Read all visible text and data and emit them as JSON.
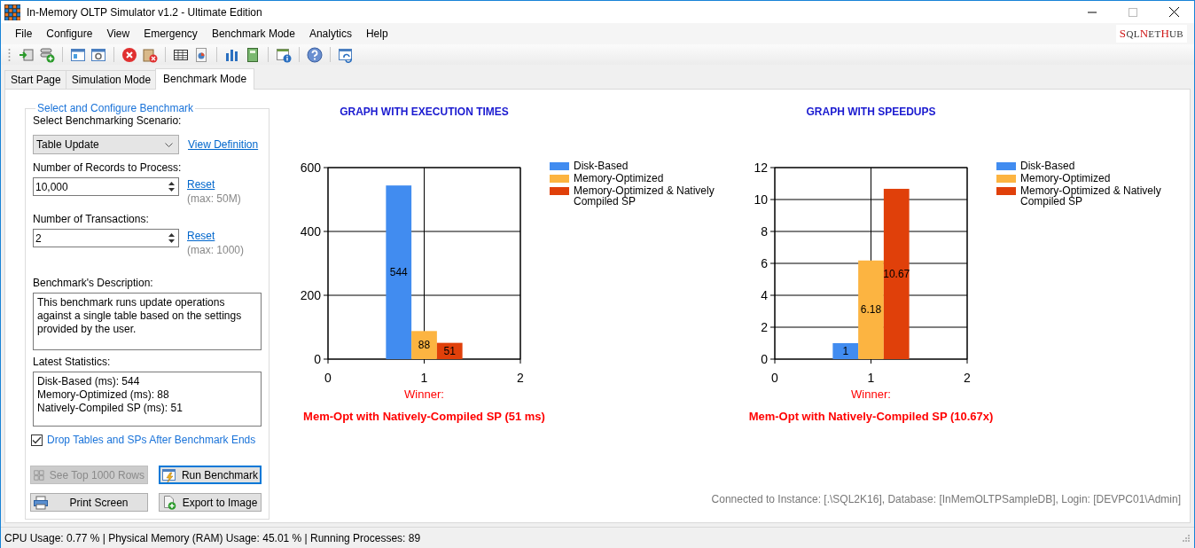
{
  "window": {
    "title": "In-Memory OLTP Simulator v1.2 - Ultimate Edition"
  },
  "menu": [
    "File",
    "Configure",
    "View",
    "Emergency",
    "Benchmark Mode",
    "Analytics",
    "Help"
  ],
  "logo": [
    {
      "text": "S",
      "accent": true
    },
    {
      "text": "QL",
      "accent": false
    },
    {
      "text": "N",
      "accent": true
    },
    {
      "text": "ET",
      "accent": false
    },
    {
      "text": "H",
      "accent": true
    },
    {
      "text": "UB",
      "accent": false
    }
  ],
  "tabs": [
    {
      "label": "Start Page",
      "selected": false
    },
    {
      "label": "Simulation Mode",
      "selected": false
    },
    {
      "label": "Benchmark Mode",
      "selected": true
    }
  ],
  "config": {
    "title": "Select and Configure Benchmark",
    "scenario_label": "Select Benchmarking Scenario:",
    "scenario": "Table Update",
    "view_definition": "View Definition",
    "fields": [
      {
        "label": "Number of Records to Process:",
        "value": "10,000",
        "reset": "Reset",
        "hint": "(max: 50M)"
      },
      {
        "label": "Number of Transactions:",
        "value": "2",
        "reset": "Reset",
        "hint": "(max: 1000)"
      }
    ],
    "description_label": "Benchmark's Description:",
    "description": "This benchmark runs update operations against a single table based on the settings provided by the user.",
    "statistics_label": "Latest Statistics:",
    "statistics": [
      "Disk-Based (ms): 544",
      "Memory-Optimized (ms): 88",
      "Natively-Compiled SP (ms): 51"
    ],
    "drop_option": {
      "label": "Drop Tables and SPs After Benchmark Ends",
      "checked": true
    },
    "buttons": [
      {
        "label": "See Top 1000 Rows",
        "disabled": true,
        "focused": false
      },
      {
        "label": "Run Benchmark",
        "disabled": false,
        "focused": true
      },
      {
        "label": "Print Screen",
        "disabled": false,
        "focused": false
      },
      {
        "label": "Export to Image",
        "disabled": false,
        "focused": false
      }
    ]
  },
  "charts": [
    {
      "title": "GRAPH WITH EXECUTION TIMES",
      "winner_label": "Winner:",
      "winner": "Mem-Opt with Natively-Compiled SP (51 ms)",
      "chart_data": {
        "type": "bar",
        "x": [
          0.735,
          1,
          1.265
        ],
        "legend": "right",
        "xlim": [
          0,
          2
        ],
        "ylim": [
          0,
          600
        ],
        "xticks": [
          0,
          1,
          2
        ],
        "yticks": [
          0,
          200,
          400,
          600
        ],
        "data_labels": true,
        "stacked": false,
        "grid": true,
        "series": [
          {
            "name": "Disk-Based",
            "color": "#418cf0",
            "values": [
              544,
              null,
              null
            ]
          },
          {
            "name": "Memory-Optimized",
            "color": "#fcb441",
            "values": [
              null,
              88,
              null
            ]
          },
          {
            "name": "Memory-Optimized & Natively Compiled SP",
            "color": "#e0400a",
            "values": [
              null,
              null,
              51
            ]
          }
        ]
      }
    },
    {
      "title": "GRAPH WITH SPEEDUPS",
      "winner_label": "Winner:",
      "winner": "Mem-Opt with Natively-Compiled SP (10.67x)",
      "chart_data": {
        "type": "bar",
        "x": [
          0.735,
          1,
          1.265
        ],
        "legend": "right",
        "xlim": [
          0,
          2
        ],
        "ylim": [
          0,
          12
        ],
        "xticks": [
          0,
          1,
          2
        ],
        "yticks": [
          0,
          2,
          4,
          6,
          8,
          10,
          12
        ],
        "data_labels": true,
        "stacked": false,
        "grid": true,
        "series": [
          {
            "name": "Disk-Based",
            "color": "#418cf0",
            "values": [
              1,
              null,
              null
            ]
          },
          {
            "name": "Memory-Optimized",
            "color": "#fcb441",
            "values": [
              null,
              6.18,
              null
            ]
          },
          {
            "name": "Memory-Optimized & Natively Compiled SP",
            "color": "#e0400a",
            "values": [
              null,
              null,
              10.67
            ]
          }
        ]
      }
    }
  ],
  "connection": "Connected to Instance: [.\\SQL2K16], Database: [InMemOLTPSampleDB], Login: [DEVPC01\\Admin]",
  "status_bar": "CPU Usage: 0.77 % | Physical Memory (RAM) Usage: 45.01 % | Running Processes: 89"
}
